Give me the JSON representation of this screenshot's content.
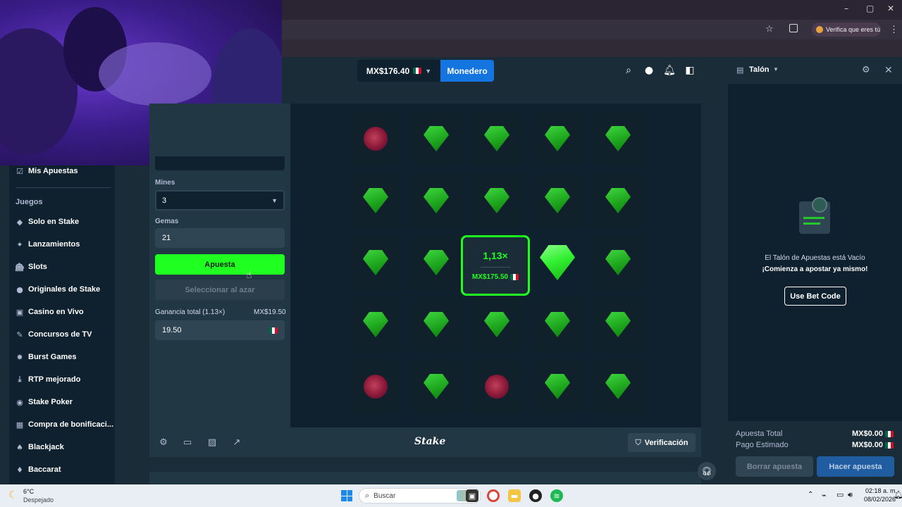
{
  "browser": {
    "window_controls": [
      "–",
      "▢",
      "✕"
    ],
    "verify_label": "Verifica que eres tú"
  },
  "header": {
    "balance": "MX$176.40",
    "wallet_label": "Monedero"
  },
  "sidebar": {
    "my_bets": "Mis Apuestas",
    "section": "Juegos",
    "items": [
      {
        "label": "Solo en Stake",
        "icon": "stake-icon"
      },
      {
        "label": "Lanzamientos",
        "icon": "sparkle-icon"
      },
      {
        "label": "Slots",
        "icon": "slots-icon"
      },
      {
        "label": "Originales de Stake",
        "icon": "originals-icon"
      },
      {
        "label": "Casino en Vivo",
        "icon": "live-casino-icon"
      },
      {
        "label": "Concursos de TV",
        "icon": "tv-icon"
      },
      {
        "label": "Burst Games",
        "icon": "burst-icon"
      },
      {
        "label": "RTP mejorado",
        "icon": "rtp-icon"
      },
      {
        "label": "Stake Poker",
        "icon": "poker-icon"
      },
      {
        "label": "Compra de bonificaci...",
        "icon": "bonus-icon"
      },
      {
        "label": "Blackjack",
        "icon": "blackjack-icon"
      },
      {
        "label": "Baccarat",
        "icon": "baccarat-icon"
      }
    ]
  },
  "controls": {
    "mines_label": "Mines",
    "mines_value": "3",
    "gems_label": "Gemas",
    "gems_value": "21",
    "bet_button": "Apuesta",
    "random_button": "Seleccionar al azar",
    "profit_label": "Ganancia total (1.13×)",
    "profit_amount": "MX$19.50",
    "profit_value": "19.50"
  },
  "board": {
    "grid": [
      [
        "mine",
        "gem",
        "gem",
        "gem",
        "gem"
      ],
      [
        "gem",
        "gem",
        "gem",
        "gem",
        "gem"
      ],
      [
        "gem",
        "gem",
        "win",
        "gem-big",
        "gem"
      ],
      [
        "gem",
        "gem",
        "gem",
        "gem",
        "gem"
      ],
      [
        "mine",
        "gem",
        "mine",
        "gem",
        "gem"
      ]
    ],
    "win_multiplier": "1,13×",
    "win_amount": "MX$175.50"
  },
  "game_footer": {
    "logo": "Stake",
    "verification": "Verificación"
  },
  "betslip": {
    "title": "Talón",
    "empty_title": "El Talón de Apuestas está Vacío",
    "empty_cta": "¡Comienza a apostar ya mismo!",
    "bet_code_button": "Use Bet Code",
    "total_bet_label": "Apuesta Total",
    "total_bet_value": "MX$0.00",
    "est_payout_label": "Pago Estimado",
    "est_payout_value": "MX$0.00",
    "clear_button": "Borrar apuesta",
    "place_button": "Hacer apuesta"
  },
  "taskbar": {
    "weather_temp": "6°C",
    "weather_desc": "Despejado",
    "search_placeholder": "Buscar",
    "time": "02:18 a. m.",
    "date": "08/02/2026"
  },
  "colors": {
    "accent_green": "#1fff20",
    "wallet_blue": "#1475e1",
    "bg_dark": "#0f212e",
    "bg_panel": "#213743"
  }
}
